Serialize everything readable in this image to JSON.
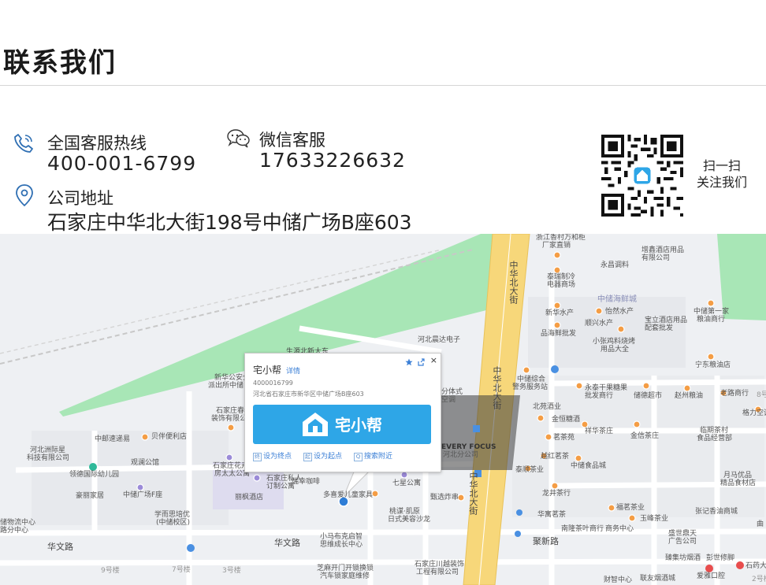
{
  "page": {
    "title": "联系我们"
  },
  "contacts": {
    "hotline": {
      "label": "全国客服热线",
      "value": "400-001-6799"
    },
    "wechat": {
      "label": "微信客服",
      "value": "17633226632"
    },
    "address": {
      "label": "公司地址",
      "value": "石家庄中华北大街198号中储广场B座603"
    }
  },
  "qr": {
    "logo_text": "宅小帮",
    "caption_line1": "扫一扫",
    "caption_line2": "关注我们"
  },
  "map": {
    "roads": {
      "zhonghua_north_1": "中华北大街",
      "zhonghua_north_2": "中华北大街",
      "zhonghua_north_3": "中华北大街",
      "huawen_left": "华文路",
      "huawen_mid": "华文路",
      "jufu": "聚新路",
      "xinbei": "生源北新大东"
    },
    "pois": [
      "浙江香村万和柜",
      "厂家直销",
      "增鑫酒店用品",
      "有限公司",
      "永昌调料",
      "泰瑞制冷",
      "电器商场",
      "中储海鲜城",
      "新华水产",
      "怡然水产",
      "顺兴水产",
      "宝立酒店用品",
      "配套批发",
      "中储第一家",
      "粮油商行",
      "品海鲜批发",
      "小张鸡料烧烤",
      "用品大全",
      "河北晨达电子",
      "宁东粮油店",
      "中储综合",
      "警务服务站",
      "永泰干果糖果",
      "批发商行",
      "储德超市",
      "赵州粮油",
      "老路商行",
      "北苑酒业",
      "格力空调",
      "金恒糖酒",
      "祥华茶庄",
      "临期茶村",
      "食品经营部",
      "茗茶苑",
      "金信茶庄",
      "越红茗茶",
      "中储食品城",
      "泰顺茶业",
      "龙井茶行",
      "月马优品",
      "精品食材店",
      "福茗茶业",
      "玉峰茶业",
      "华寓茗茶",
      "南隆茶叶商行",
      "商务中心",
      "张记香油商城",
      "盛世鼎天",
      "广告公司",
      "新华公安分",
      "派出所中储",
      "石家庄春花",
      "装饰有限公司",
      "中邮速递易",
      "贝伴便利店",
      "河北洲际星",
      "科技有限公司",
      "观澜公馆",
      "领德国际幼儿园",
      "豪丽家居",
      "中储广场F座",
      "学而思培优",
      "(中储校区)",
      "储物流中心",
      "路分中心",
      "石家庄花卉",
      "房太太公寓",
      "石家庄私人",
      "订制公寓",
      "瑞幸咖啡",
      "丽枫酒店",
      "七星公寓",
      "甄选炸串",
      "多喜爱儿童家具",
      "小马布克启智",
      "思维成长中心",
      "桃谋·肌原",
      "日式美容沙龙",
      "芝麻开门开锁换锁",
      "汽车锁家庭维修",
      "石家庄川越装饰",
      "工程有限公司",
      "EVERY FOCUS",
      "河北分公司",
      "分体式",
      "空调",
      "臻集坊烟酒",
      "彭世修脚",
      "石药大",
      "财智中心",
      "联友烟酒城",
      "爱雅口腔",
      "9号楼",
      "7号楼",
      "3号楼",
      "8号楼",
      "2号楼",
      "曲"
    ],
    "popup": {
      "title": "宅小帮",
      "detail_link": "详情",
      "phone": "4000016799",
      "address": "河北省石家庄市新华区中储广场B座603",
      "logo_text": "宅小帮",
      "close": "×",
      "actions": [
        {
          "icon": "终",
          "label": "设为终点"
        },
        {
          "icon": "起",
          "label": "设为起点"
        },
        {
          "icon": "Q",
          "label": "搜索附近"
        }
      ]
    }
  },
  "colors": {
    "accent": "#2ea6e7",
    "link": "#3b7fd6",
    "green_area": "#9fe3b0",
    "main_road": "#f7d77a",
    "map_bg": "#eef0f3",
    "poi_orange": "#f49d45"
  }
}
